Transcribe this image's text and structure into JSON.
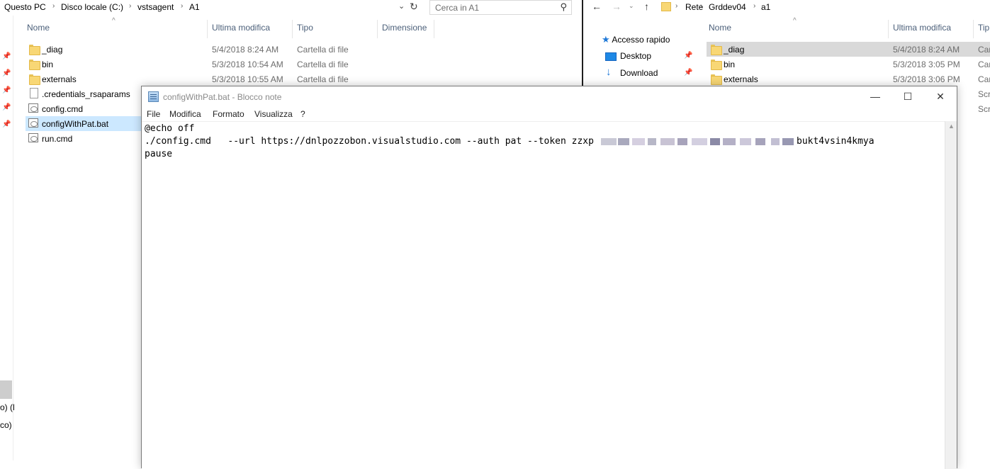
{
  "left_explorer": {
    "breadcrumb": [
      "Questo PC",
      "Disco locale (C:)",
      "vstsagent",
      "A1"
    ],
    "search_placeholder": "Cerca in A1",
    "columns": {
      "name": "Nome",
      "modified": "Ultima modifica",
      "type": "Tipo",
      "size": "Dimensione"
    },
    "files": [
      {
        "name": "_diag",
        "modified": "5/4/2018 8:24 AM",
        "type": "Cartella di file",
        "icon": "folder-icon"
      },
      {
        "name": "bin",
        "modified": "5/3/2018 10:54 AM",
        "type": "Cartella di file",
        "icon": "folder-icon"
      },
      {
        "name": "externals",
        "modified": "5/3/2018 10:55 AM",
        "type": "Cartella di file",
        "icon": "folder-icon"
      },
      {
        "name": ".credentials_rsaparams",
        "modified": "",
        "type": "",
        "icon": "file-icon"
      },
      {
        "name": "config.cmd",
        "modified": "",
        "type": "",
        "icon": "cmd-file-icon"
      },
      {
        "name": "configWithPat.bat",
        "modified": "",
        "type": "",
        "icon": "cmd-file-icon",
        "selected": true
      },
      {
        "name": "run.cmd",
        "modified": "",
        "type": "",
        "icon": "cmd-file-icon"
      }
    ],
    "cut_texts": [
      "o) (l",
      "co)"
    ]
  },
  "right_explorer": {
    "breadcrumb": [
      "Rete",
      "Grddev04",
      "a1"
    ],
    "nav_tree": {
      "quick_access": "Accesso rapido",
      "desktop": "Desktop",
      "download": "Download"
    },
    "columns": {
      "name": "Nome",
      "modified": "Ultima modifica",
      "type": "Tip"
    },
    "files": [
      {
        "name": "_diag",
        "modified": "5/4/2018 8:24 AM",
        "type": "Car",
        "selected": true
      },
      {
        "name": "bin",
        "modified": "5/3/2018 3:05 PM",
        "type": "Car"
      },
      {
        "name": "externals",
        "modified": "5/3/2018 3:06 PM",
        "type": "Car"
      }
    ],
    "extra_types": [
      "Scri",
      "Scri"
    ]
  },
  "notepad": {
    "title": "configWithPat.bat - Blocco note",
    "menu": [
      "File",
      "Modifica",
      "Formato",
      "Visualizza",
      "?"
    ],
    "lines": [
      "@echo off",
      "./config.cmd   --url https://dnlpozzobon.visualstudio.com --auth pat --token zzxp",
      "pause"
    ],
    "line2_suffix": "bukt4vsin4kmya",
    "controls": {
      "minimize": "—",
      "maximize": "☐",
      "close": "✕"
    }
  },
  "colors": {
    "selection": "#cce8ff",
    "header_text": "#4c607a",
    "folder": "#f8d775"
  }
}
